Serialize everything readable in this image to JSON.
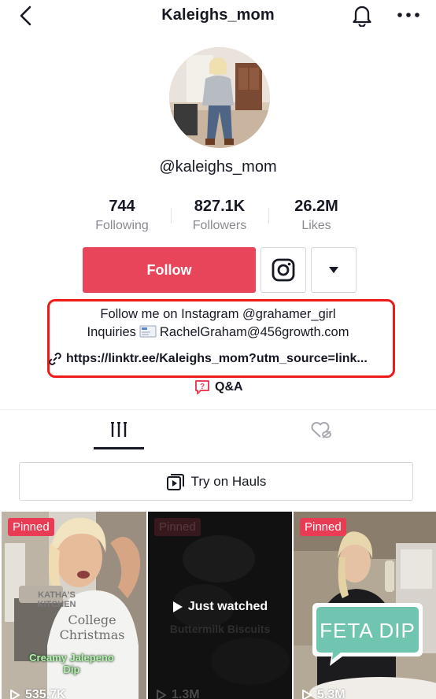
{
  "header": {
    "title": "Kaleighs_mom",
    "back_icon": "chevron-left-icon",
    "bell_icon": "bell-icon",
    "more_icon": "more-dots-icon"
  },
  "profile": {
    "username": "@kaleighs_mom",
    "stats": [
      {
        "value": "744",
        "label": "Following"
      },
      {
        "value": "827.1K",
        "label": "Followers"
      },
      {
        "value": "26.2M",
        "label": "Likes"
      }
    ],
    "follow_label": "Follow",
    "bio_line1": "Follow me on Instagram @grahamer_girl",
    "bio_line2_prefix": "Inquiries",
    "bio_line2_email": "RachelGraham@456growth.com",
    "bio_link": "https://linktr.ee/Kaleighs_mom?utm_source=link...",
    "qa_label": "Q&A"
  },
  "hauls_label": "Try on Hauls",
  "videos": [
    {
      "pinned": "Pinned",
      "views": "535.7K",
      "caption": "Creamy Jalepeno Dip",
      "shirt_text": "College Christmas",
      "sign_text": "KATHA'S KITCHEN"
    },
    {
      "pinned": "Pinned",
      "views": "1.3M",
      "status": "Just watched",
      "caption": "Buttermilk Biscuits"
    },
    {
      "pinned": "Pinned",
      "views": "5.3M",
      "caption": "FETA DIP"
    }
  ],
  "colors": {
    "accent": "#e8445a",
    "highlight_box": "#ee1a1a",
    "muted_text": "#8a8b91"
  }
}
